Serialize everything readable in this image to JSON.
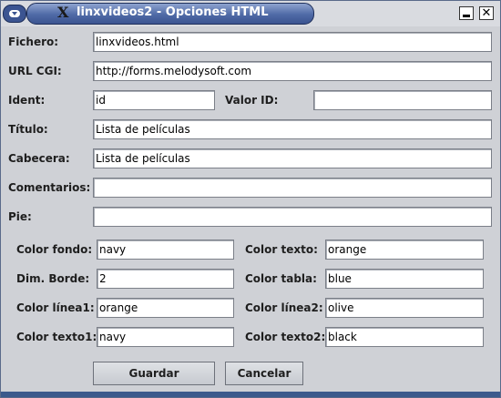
{
  "window": {
    "title": "linxvideos2 - Opciones HTML",
    "close_glyph": "✕"
  },
  "fields": {
    "fichero": {
      "label": "Fichero:",
      "value": "linxvideos.html"
    },
    "url_cgi": {
      "label": "URL CGI:",
      "value": "http://forms.melodysoft.com"
    },
    "ident": {
      "label": "Ident:",
      "value": "id"
    },
    "valor_id": {
      "label": "Valor ID:",
      "value": ""
    },
    "titulo": {
      "label": "Título:",
      "value": "Lista de películas"
    },
    "cabecera": {
      "label": "Cabecera:",
      "value": "Lista de películas"
    },
    "comentarios": {
      "label": "Comentarios:",
      "value": ""
    },
    "pie": {
      "label": "Pie:",
      "value": ""
    }
  },
  "colors": {
    "color_fondo": {
      "label": "Color fondo:",
      "value": "navy"
    },
    "color_texto": {
      "label": "Color texto:",
      "value": "orange"
    },
    "dim_borde": {
      "label": "Dim. Borde:",
      "value": "2"
    },
    "color_tabla": {
      "label": "Color tabla:",
      "value": "blue"
    },
    "color_linea1": {
      "label": "Color línea1:",
      "value": "orange"
    },
    "color_linea2": {
      "label": "Color línea2:",
      "value": "olive"
    },
    "color_texto1": {
      "label": "Color texto1:",
      "value": "navy"
    },
    "color_texto2": {
      "label": "Color texto2:",
      "value": "black"
    }
  },
  "buttons": {
    "guardar": "Guardar",
    "cancelar": "Cancelar"
  }
}
